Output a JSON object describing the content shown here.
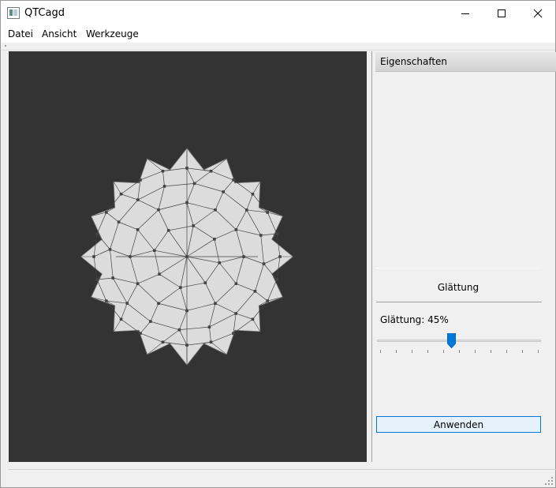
{
  "window": {
    "title": "QTCagd"
  },
  "menu": {
    "items": [
      "Datei",
      "Ansicht",
      "Werkzeuge"
    ]
  },
  "properties": {
    "header": "Eigenschaften",
    "section_title": "Glättung",
    "slider_label": "Glättung: 45%",
    "slider_value": 0.45,
    "apply_label": "Anwenden"
  },
  "colors": {
    "canvas_bg": "#333333",
    "mesh_fill": "#dcdcdc",
    "mesh_stroke": "#444444",
    "accent": "#0078d7"
  },
  "icons": [
    "app-icon",
    "minimize-icon",
    "maximize-icon",
    "close-icon",
    "resize-grip-icon"
  ]
}
